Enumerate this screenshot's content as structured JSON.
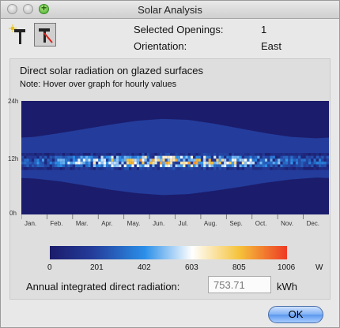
{
  "window": {
    "title": "Solar Analysis"
  },
  "info": {
    "selected_openings_label": "Selected Openings:",
    "selected_openings_value": "1",
    "orientation_label": "Orientation:",
    "orientation_value": "East"
  },
  "graph": {
    "heading": "Direct solar radiation on glazed surfaces",
    "note": "Note: Hover over graph for hourly values",
    "y_ticks": [
      "24h",
      "12h",
      "0h"
    ],
    "months": [
      "Jan.",
      "Feb.",
      "Mar.",
      "Apr.",
      "May.",
      "Jun.",
      "Jul.",
      "Aug.",
      "Sep.",
      "Oct.",
      "Nov.",
      "Dec."
    ]
  },
  "legend": {
    "ticks": [
      "0",
      "201",
      "402",
      "603",
      "805",
      "1006"
    ],
    "unit": "W",
    "colors": [
      "#1b1c6b",
      "#2a7de0",
      "#ffffff",
      "#f5c93a",
      "#ee3a24"
    ]
  },
  "annual": {
    "label": "Annual integrated direct radiation:",
    "value": "753.71",
    "unit": "kWh"
  },
  "ok_label": "OK",
  "chart_data": {
    "type": "heatmap",
    "x": "day of year",
    "y": "hour of day",
    "ylim": [
      0,
      24
    ],
    "value_range": [
      0,
      1006
    ],
    "value_unit": "W",
    "months": [
      "Jan.",
      "Feb.",
      "Mar.",
      "Apr.",
      "May.",
      "Jun.",
      "Jul.",
      "Aug.",
      "Sep.",
      "Oct.",
      "Nov.",
      "Dec."
    ],
    "sunrise_hours_by_month": [
      7.6,
      7.0,
      6.1,
      5.2,
      4.5,
      4.1,
      4.3,
      5.0,
      5.8,
      6.7,
      7.4,
      7.8
    ],
    "sunset_hours_by_month": [
      16.4,
      17.2,
      18.1,
      19.0,
      19.8,
      20.2,
      20.0,
      19.2,
      18.2,
      17.2,
      16.4,
      16.1
    ],
    "radiation_start_hour": 9.4,
    "radiation_end_hour": 13.0,
    "peak_radiation_by_month_w": [
      420,
      560,
      720,
      870,
      960,
      1006,
      990,
      900,
      760,
      600,
      450,
      380
    ]
  }
}
